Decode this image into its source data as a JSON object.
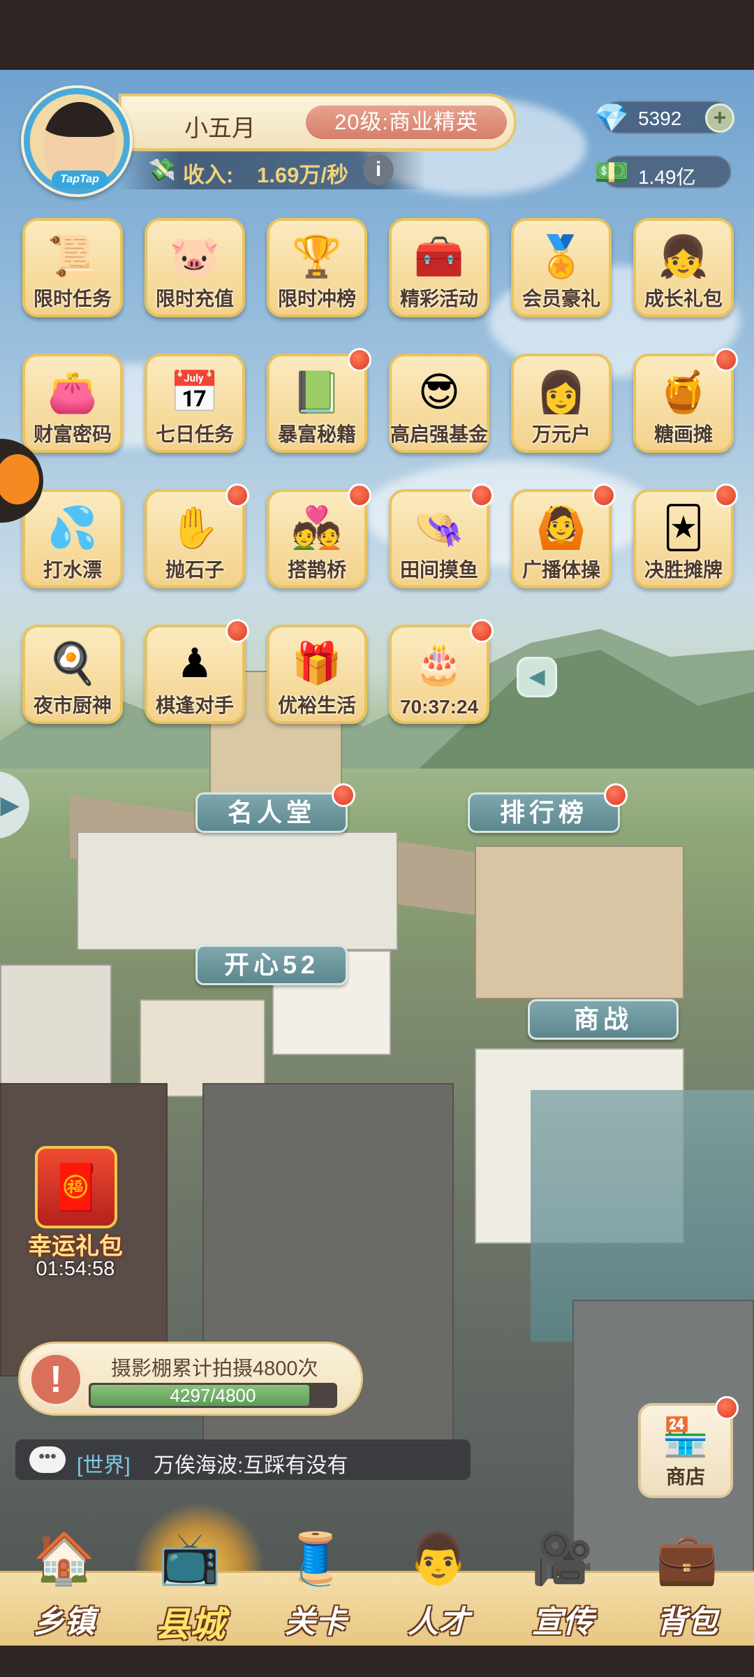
{
  "player": {
    "name": "小五月",
    "level": "20级:商业精英",
    "avatar_tag": "TapTap",
    "income_label": "收入:",
    "income_value": "1.69万/秒"
  },
  "currency": {
    "gems": "5392",
    "money": "1.49亿"
  },
  "activities": [
    {
      "label": "限时任务",
      "icon": "scroll-clock-icon",
      "badge": false
    },
    {
      "label": "限时充值",
      "icon": "piggy-bank-icon",
      "badge": false
    },
    {
      "label": "限时冲榜",
      "icon": "trophy-clock-icon",
      "badge": false
    },
    {
      "label": "精彩活动",
      "icon": "treasure-chest-icon",
      "badge": false
    },
    {
      "label": "会员豪礼",
      "icon": "vip-badge-icon",
      "badge": false
    },
    {
      "label": "成长礼包",
      "icon": "girl-portrait-icon",
      "badge": false
    },
    {
      "label": "财富密码",
      "icon": "wallet-key-icon",
      "badge": false
    },
    {
      "label": "七日任务",
      "icon": "calendar-icon",
      "badge": false
    },
    {
      "label": "暴富秘籍",
      "icon": "green-book-icon",
      "badge": true
    },
    {
      "label": "高启强基金",
      "icon": "sunglasses-man-icon",
      "badge": false
    },
    {
      "label": "万元户",
      "icon": "lady-portrait-icon",
      "badge": false
    },
    {
      "label": "糖画摊",
      "icon": "sugar-painting-icon",
      "badge": true
    },
    {
      "label": "打水漂",
      "icon": "water-splash-icon",
      "badge": false
    },
    {
      "label": "抛石子",
      "icon": "stones-hand-icon",
      "badge": true
    },
    {
      "label": "搭鹊桥",
      "icon": "couple-bridge-icon",
      "badge": true
    },
    {
      "label": "田间摸鱼",
      "icon": "straw-hat-icon",
      "badge": true
    },
    {
      "label": "广播体操",
      "icon": "exercise-boy-icon",
      "badge": true
    },
    {
      "label": "决胜摊牌",
      "icon": "card-lady-icon",
      "badge": true
    },
    {
      "label": "夜市厨神",
      "icon": "wok-icon",
      "badge": false
    },
    {
      "label": "棋逢对手",
      "icon": "chess-pieces-icon",
      "badge": true
    },
    {
      "label": "优裕生活",
      "icon": "gift-box-icon",
      "badge": false
    },
    {
      "label": "70:37:24",
      "icon": "cake-icon",
      "badge": true
    }
  ],
  "map_labels": {
    "hall_of_fame": "名人堂",
    "leaderboard": "排行榜",
    "happy52": "开心52",
    "business_war": "商战"
  },
  "lucky_gift": {
    "title": "幸运礼包",
    "timer": "01:54:58"
  },
  "quest": {
    "text": "摄影棚累计拍摄4800次",
    "progress": "4297/4800",
    "progress_fraction": 0.895
  },
  "chat": {
    "channel": "[世界]",
    "message": "万俟海波:互踩有没有"
  },
  "shop": {
    "label": "商店"
  },
  "nav": [
    {
      "label": "乡镇",
      "icon": "town-house-icon"
    },
    {
      "label": "县城",
      "icon": "television-icon"
    },
    {
      "label": "关卡",
      "icon": "sewing-machine-icon"
    },
    {
      "label": "人才",
      "icon": "talent-man-icon"
    },
    {
      "label": "宣传",
      "icon": "film-projector-icon"
    },
    {
      "label": "背包",
      "icon": "backpack-icon"
    }
  ],
  "colors": {
    "badge_red": "#d93d22",
    "card_gold": "#e9c35e",
    "label_teal": "#5d878e",
    "nav_gold": "#e7c681",
    "income_gold": "#f3d27a"
  }
}
